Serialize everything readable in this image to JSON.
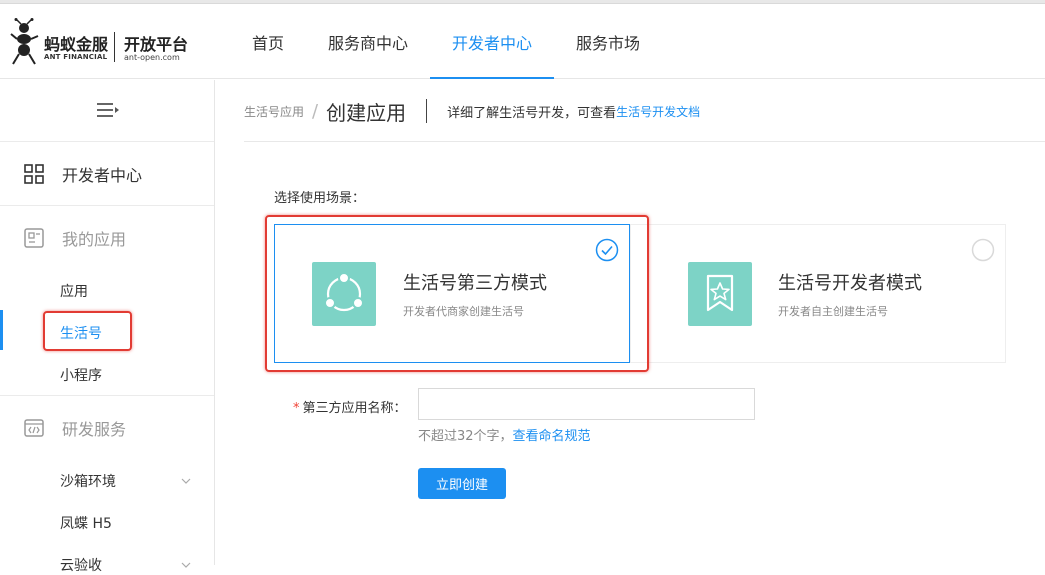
{
  "header": {
    "logo": {
      "brand_cn": "蚂蚁金服",
      "brand_en": "ANT FINANCIAL",
      "platform_cn": "开放平台",
      "platform_en": "ant-open.com"
    },
    "nav": [
      {
        "label": "首页",
        "active": false
      },
      {
        "label": "服务商中心",
        "active": false
      },
      {
        "label": "开发者中心",
        "active": true
      },
      {
        "label": "服务市场",
        "active": false
      }
    ]
  },
  "sidebar": {
    "developer_center": "开发者中心",
    "my_apps": "我的应用",
    "my_apps_items": [
      {
        "label": "应用",
        "active": false
      },
      {
        "label": "生活号",
        "active": true
      },
      {
        "label": "小程序",
        "active": false
      }
    ],
    "dev_services": "研发服务",
    "dev_services_items": [
      {
        "label": "沙箱环境",
        "expandable": true
      },
      {
        "label": "凤蝶 H5",
        "expandable": false
      },
      {
        "label": "云验收",
        "expandable": true
      }
    ]
  },
  "breadcrumb": {
    "parent": "生活号应用",
    "separator": "/",
    "title": "创建应用",
    "desc": "详细了解生活号开发，可查看",
    "link": "生活号开发文档"
  },
  "form": {
    "scene_label": "选择使用场景：",
    "cards": [
      {
        "title": "生活号第三方模式",
        "desc": "开发者代商家创建生活号",
        "selected": true,
        "icon": "share-nodes-icon"
      },
      {
        "title": "生活号开发者模式",
        "desc": "开发者自主创建生活号",
        "selected": false,
        "icon": "star-badge-icon"
      }
    ],
    "name_label": "第三方应用名称：",
    "required_mark": "*",
    "name_value": "",
    "help_text": "不超过32个字，",
    "help_link": "查看命名规范",
    "submit_label": "立即创建"
  },
  "colors": {
    "accent": "#1c8ff1",
    "icon_bg": "#7dd3c6",
    "highlight": "#e23b33"
  }
}
